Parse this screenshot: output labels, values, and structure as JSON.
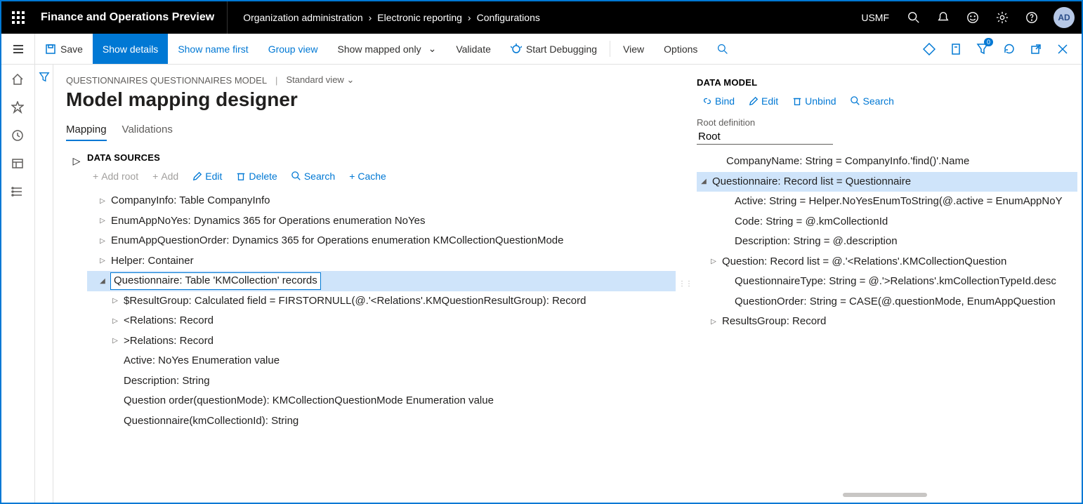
{
  "top": {
    "app_title": "Finance and Operations Preview",
    "breadcrumbs": [
      "Organization administration",
      "Electronic reporting",
      "Configurations"
    ],
    "company": "USMF",
    "avatar": "AD"
  },
  "cmd": {
    "save": "Save",
    "show_details": "Show details",
    "show_name_first": "Show name first",
    "group_view": "Group view",
    "show_mapped_only": "Show mapped only",
    "validate": "Validate",
    "start_debugging": "Start Debugging",
    "view": "View",
    "options": "Options",
    "req_badge": "0"
  },
  "header": {
    "model_path": "QUESTIONNAIRES QUESTIONNAIRES MODEL",
    "view_name": "Standard view",
    "page_title": "Model mapping designer"
  },
  "tabs": {
    "mapping": "Mapping",
    "validations": "Validations"
  },
  "ds": {
    "heading": "DATA SOURCES",
    "toolbar": {
      "add_root": "Add root",
      "add": "Add",
      "edit": "Edit",
      "delete": "Delete",
      "search": "Search",
      "cache": "Cache"
    },
    "tree": [
      {
        "label": "CompanyInfo: Table CompanyInfo",
        "level": 0,
        "caret": "▷"
      },
      {
        "label": "EnumAppNoYes: Dynamics 365 for Operations enumeration NoYes",
        "level": 0,
        "caret": "▷"
      },
      {
        "label": "EnumAppQuestionOrder: Dynamics 365 for Operations enumeration KMCollectionQuestionMode",
        "level": 0,
        "caret": "▷"
      },
      {
        "label": "Helper: Container",
        "level": 0,
        "caret": "▷"
      },
      {
        "label": "Questionnaire: Table 'KMCollection' records",
        "level": 0,
        "caret": "◢",
        "selected": true
      },
      {
        "label": "$ResultGroup: Calculated field = FIRSTORNULL(@.'<Relations'.KMQuestionResultGroup): Record",
        "level": 1,
        "caret": "▷"
      },
      {
        "label": "<Relations: Record",
        "level": 1,
        "caret": "▷"
      },
      {
        "label": ">Relations: Record",
        "level": 1,
        "caret": "▷"
      },
      {
        "label": "Active: NoYes Enumeration value",
        "level": 1,
        "caret": ""
      },
      {
        "label": "Description: String",
        "level": 1,
        "caret": ""
      },
      {
        "label": "Question order(questionMode): KMCollectionQuestionMode Enumeration value",
        "level": 1,
        "caret": ""
      },
      {
        "label": "Questionnaire(kmCollectionId): String",
        "level": 1,
        "caret": ""
      }
    ]
  },
  "dm": {
    "heading": "DATA MODEL",
    "toolbar": {
      "bind": "Bind",
      "edit": "Edit",
      "unbind": "Unbind",
      "search": "Search"
    },
    "root_def_label": "Root definition",
    "root_def_value": "Root",
    "tree": [
      {
        "label": "CompanyName: String = CompanyInfo.'find()'.Name",
        "lvl": "dmlvl0",
        "caret": ""
      },
      {
        "label": "Questionnaire: Record list = Questionnaire",
        "lvl": "dmlvl1",
        "caret": "◢",
        "selected": true
      },
      {
        "label": "Active: String = Helper.NoYesEnumToString(@.active = EnumAppNoY",
        "lvl": "dmlvl2",
        "caret": ""
      },
      {
        "label": "Code: String = @.kmCollectionId",
        "lvl": "dmlvl2",
        "caret": ""
      },
      {
        "label": "Description: String = @.description",
        "lvl": "dmlvl2",
        "caret": ""
      },
      {
        "label": "Question: Record list = @.'<Relations'.KMCollectionQuestion",
        "lvl": "dmlvl2c",
        "caret": "▷"
      },
      {
        "label": "QuestionnaireType: String = @.'>Relations'.kmCollectionTypeId.desc",
        "lvl": "dmlvl2",
        "caret": ""
      },
      {
        "label": "QuestionOrder: String = CASE(@.questionMode, EnumAppQuestion",
        "lvl": "dmlvl2",
        "caret": ""
      },
      {
        "label": "ResultsGroup: Record",
        "lvl": "dmlvl2c",
        "caret": "▷"
      }
    ]
  }
}
